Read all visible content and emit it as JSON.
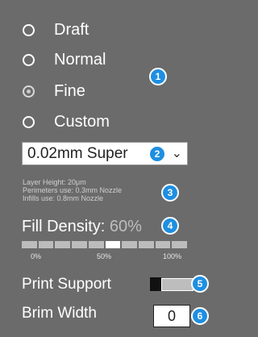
{
  "quality": {
    "options": [
      {
        "label": "Draft",
        "selected": false
      },
      {
        "label": "Normal",
        "selected": false
      },
      {
        "label": "Fine",
        "selected": true
      },
      {
        "label": "Custom",
        "selected": false
      }
    ]
  },
  "preset_select": {
    "value": "0.02mm Super",
    "icon": "chevron-down-icon"
  },
  "info": {
    "layer_height": "Layer Height: 20μm",
    "perimeters": "Perimeters use: 0.3mm Nozzle",
    "infills": "Infills use: 0.8mm Nozzle"
  },
  "fill_density": {
    "label": "Fill Density:",
    "value_text": "60%",
    "value_fraction": 0.6,
    "segments": 10,
    "ticks": {
      "min": "0%",
      "mid": "50%",
      "max": "100%"
    }
  },
  "print_support": {
    "label": "Print Support",
    "enabled": false
  },
  "brim_width": {
    "label": "Brim Width",
    "value": "0"
  },
  "badges": [
    "1",
    "2",
    "3",
    "4",
    "5",
    "6"
  ],
  "colors": {
    "accent": "#1e8fe1",
    "background": "#6b6b6b"
  }
}
